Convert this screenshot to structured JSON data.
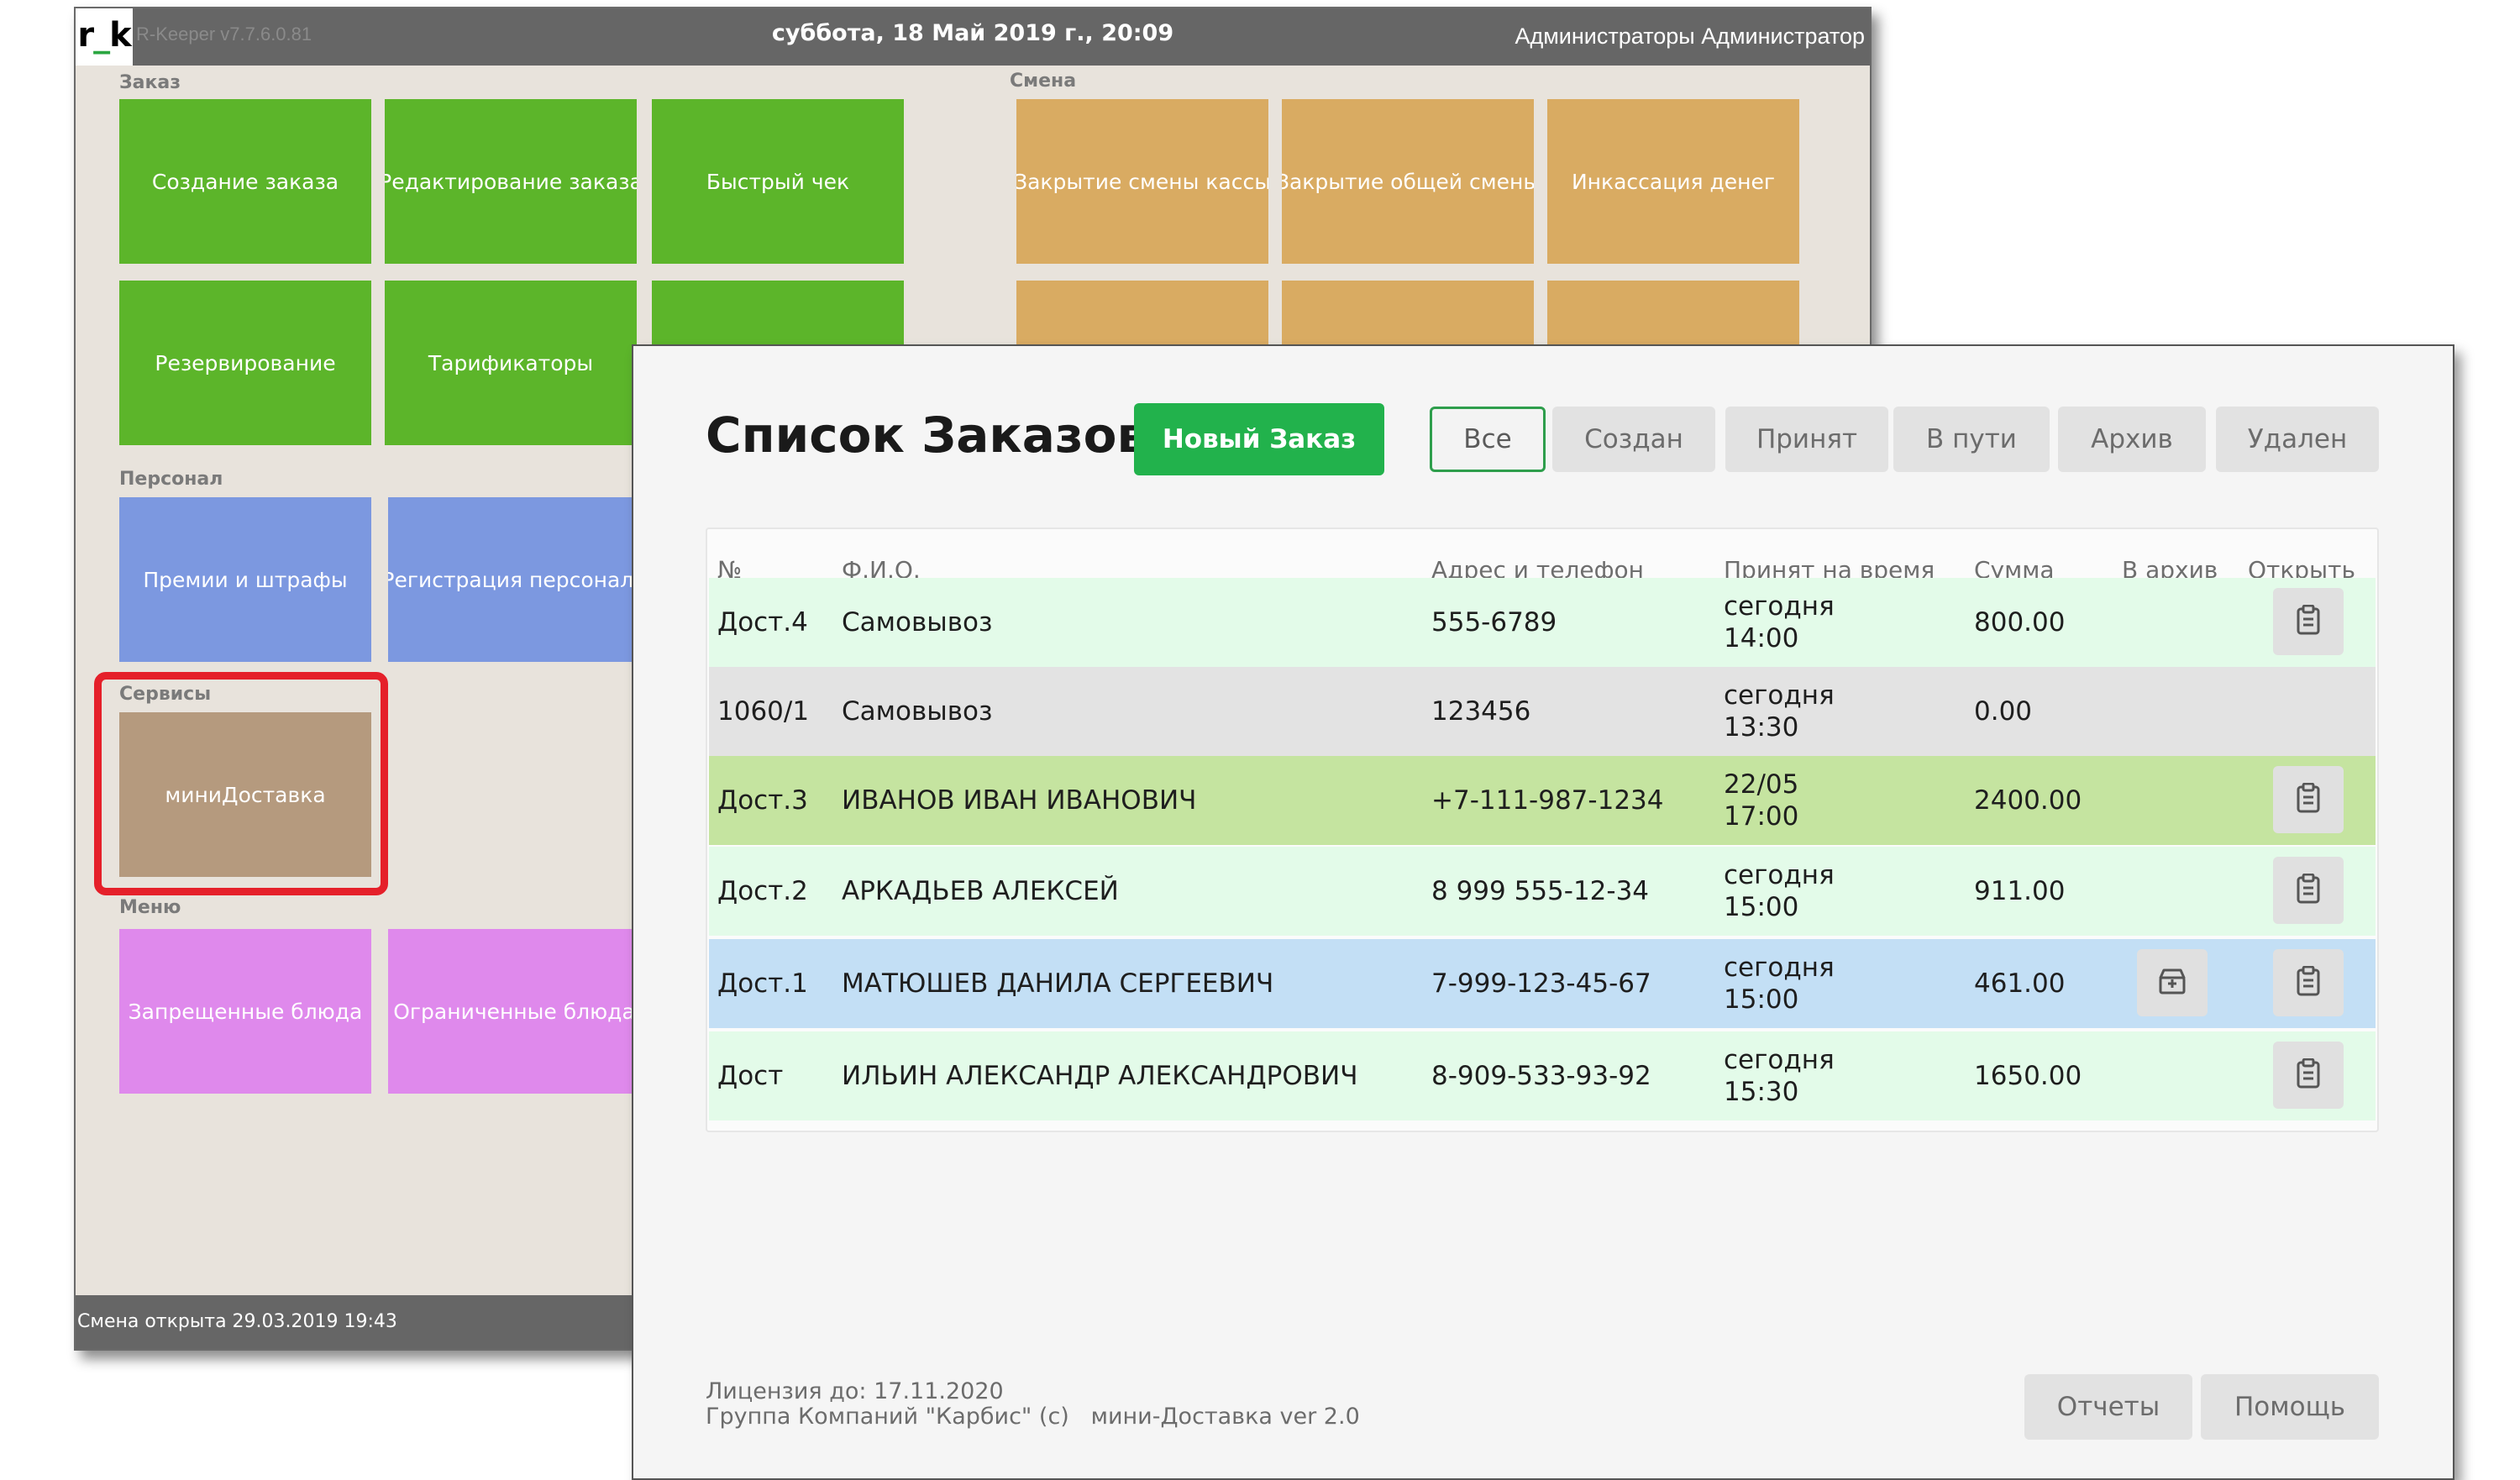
{
  "rkeeper": {
    "logo_main": "r",
    "logo_us": "_",
    "logo_k": "k",
    "version": "R-Keeper v7.7.6.0.81",
    "datetime": "суббота, 18 Май 2019 г., 20:09",
    "user": "Администраторы Администратор",
    "sections": {
      "order": "Заказ",
      "shift": "Смена",
      "staff": "Персонал",
      "services": "Сервисы",
      "menu": "Меню"
    },
    "tiles": {
      "create_order": "Создание заказа",
      "edit_order": "Редактирование заказа",
      "quick_check": "Быстрый чек",
      "close_cash_shift": "Закрытие смены кассы",
      "close_common_shift": "Закрытие общей смены",
      "cash_collection": "Инкассация денег",
      "reservation": "Резервирование",
      "tariffs": "Тарификаторы",
      "bonuses": "Премии и штрафы",
      "staff_registration": "Регистрация персонала",
      "mini_delivery": "миниДоставка",
      "forbidden_dishes": "Запрещенные блюда",
      "limited_dishes": "Ограниченные блюда"
    },
    "status": "Смена открыта 29.03.2019 19:43",
    "colors": {
      "order": "#5cb52a",
      "shift": "#d9ab62",
      "staff": "#7c98e0",
      "services": "#b59a7e",
      "menu": "#df89ec",
      "highlight": "#e5202a"
    }
  },
  "mini": {
    "title": "Список Заказов",
    "new_order": "Новый Заказ",
    "filters": [
      "Все",
      "Создан",
      "Принят",
      "В пути",
      "Архив",
      "Удален"
    ],
    "active_filter": "Все",
    "columns": {
      "num": "№",
      "name": "Ф.И.О.",
      "address": "Адрес и телефон",
      "time": "Принят на время",
      "sum": "Сумма",
      "archive": "В архив",
      "open": "Открыть"
    },
    "rows": [
      {
        "num": "Дост.4",
        "name": "Самовывоз",
        "phone": "555-6789",
        "day": "сегодня",
        "time": "14:00",
        "sum": "800.00",
        "bg": "#e3fbe9",
        "archive": false,
        "open": true
      },
      {
        "num": "1060/1",
        "name": "Самовывоз",
        "phone": "123456",
        "day": "сегодня",
        "time": "13:30",
        "sum": "0.00",
        "bg": "#e3e3e3",
        "archive": false,
        "open": false
      },
      {
        "num": "Дост.3",
        "name": "ИВАНОВ ИВАН ИВАНОВИЧ",
        "phone": "+7-111-987-1234",
        "day": "22/05",
        "time": "17:00",
        "sum": "2400.00",
        "bg": "#c5e4a0",
        "archive": false,
        "open": true
      },
      {
        "num": "Дост.2",
        "name": "АРКАДЬЕВ АЛЕКСЕЙ",
        "phone": "8 999 555-12-34",
        "day": "сегодня",
        "time": "15:00",
        "sum": "911.00",
        "bg": "#e3fbe9",
        "archive": false,
        "open": true
      },
      {
        "num": "Дост.1",
        "name": "МАТЮШЕВ ДАНИЛА СЕРГЕЕВИЧ",
        "phone": "7-999-123-45-67",
        "day": "сегодня",
        "time": "15:00",
        "sum": "461.00",
        "bg": "#c3dff5",
        "archive": true,
        "open": true
      },
      {
        "num": "Дост",
        "name": "ИЛЬИН АЛЕКСАНДР АЛЕКСАНДРОВИЧ",
        "phone": "8-909-533-93-92",
        "day": "сегодня",
        "time": "15:30",
        "sum": "1650.00",
        "bg": "#e3fbe9",
        "archive": false,
        "open": true
      }
    ],
    "license": "Лицензия до: 17.11.2020",
    "company": "Группа Компаний \"Карбис\" (с)",
    "version": "мини-Доставка ver 2.0",
    "reports": "Отчеты",
    "help": "Помощь",
    "icons": {
      "open": "clipboard-icon",
      "archive": "archive-box-icon"
    },
    "colors": {
      "accent": "#22b24c",
      "active_border": "#2e9e4c"
    }
  }
}
